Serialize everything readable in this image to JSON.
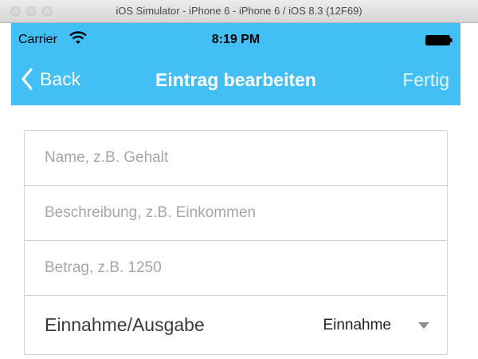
{
  "window": {
    "title": "iOS Simulator - iPhone 6 - iPhone 6 / iOS 8.3 (12F69)"
  },
  "statusbar": {
    "carrier": "Carrier",
    "time": "8:19 PM"
  },
  "navbar": {
    "back_label": "Back",
    "title": "Eintrag bearbeiten",
    "done_label": "Fertig",
    "color": "#42bff5"
  },
  "form": {
    "name_placeholder": "Name, z.B. Gehalt",
    "name_value": "",
    "description_placeholder": "Beschreibung, z.B. Einkommen",
    "description_value": "",
    "amount_placeholder": "Betrag, z.B. 1250",
    "amount_value": "",
    "type_label": "Einnahme/Ausgabe",
    "type_value": "Einnahme"
  },
  "icons": [
    "wifi-icon",
    "battery-icon",
    "chevron-left-icon",
    "caret-down-icon"
  ]
}
